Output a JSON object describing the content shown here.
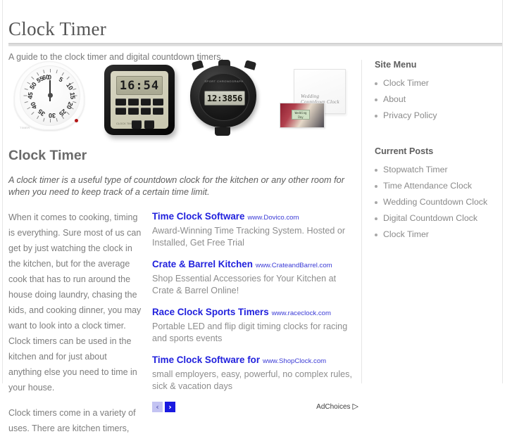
{
  "header": {
    "title": "Clock Timer",
    "tagline": "A guide to the clock timer and digital countdown timers."
  },
  "images": [
    {
      "name": "mechanical-kitchen-timer",
      "dial_numbers": [
        "0",
        "5",
        "10",
        "15",
        "20",
        "25",
        "30",
        "35",
        "40",
        "45",
        "50",
        "55",
        "60"
      ],
      "brand": "TIMER"
    },
    {
      "name": "digital-square-timer",
      "display": "16:54",
      "label": "CLOCK\nTIMER"
    },
    {
      "name": "digital-stopwatch",
      "display": "12:3856",
      "brand": "SPORT\nCHRONOGRAPH"
    },
    {
      "name": "wedding-countdown-clock-box",
      "script_text": "Wedding Countdown Clock",
      "card_display": "Wedding Day"
    }
  ],
  "article": {
    "title": "Clock Timer",
    "lead": "A clock timer is a useful type of countdown clock for the kitchen or any other room for when you need to keep track of a certain time limit.",
    "paragraphs": [
      "When it comes to cooking, timing is everything.  Sure most of us can get by just watching the clock in the kitchen, but for the average cook that has to run around the house doing laundry, chasing the kids, and cooking dinner, you may want to look into a clock timer. Clock timers can be used in the kitchen and for just about anything else you need to time in your house.",
      "Clock timers come in a variety of uses.  There are kitchen timers,"
    ]
  },
  "ads": {
    "items": [
      {
        "title": "Time Clock Software",
        "url": "www.Dovico.com",
        "description": "Award-Winning Time Tracking System. Hosted or Installed, Get Free Trial"
      },
      {
        "title": "Crate & Barrel Kitchen",
        "url": "www.CrateandBarrel.com",
        "description": "Shop Essential Accessories for Your Kitchen at Crate & Barrel Online!"
      },
      {
        "title": "Race Clock Sports Timers",
        "url": "www.raceclock.com",
        "description": "Portable LED and flip digit timing clocks for racing and sports events"
      },
      {
        "title": "Time Clock Software for",
        "url": "www.ShopClock.com",
        "description": "small employers, easy, powerful, no complex rules, sick & vacation days"
      }
    ],
    "prev_label": "‹",
    "next_label": "›",
    "adchoices_label": "AdChoices",
    "adchoices_icon": "▷",
    "colors": {
      "title": "#2121dd",
      "url": "#3a3ad6",
      "prev_bg": "#c3c3f2",
      "next_bg": "#1a1ae0"
    }
  },
  "sidebar": {
    "sections": [
      {
        "heading": "Site Menu",
        "items": [
          "Clock Timer",
          "About",
          "Privacy Policy"
        ]
      },
      {
        "heading": "Current Posts",
        "items": [
          "Stopwatch Timer",
          "Time Attendance Clock",
          "Wedding Countdown Clock",
          "Digital Countdown Clock",
          "Clock Timer"
        ]
      }
    ]
  }
}
